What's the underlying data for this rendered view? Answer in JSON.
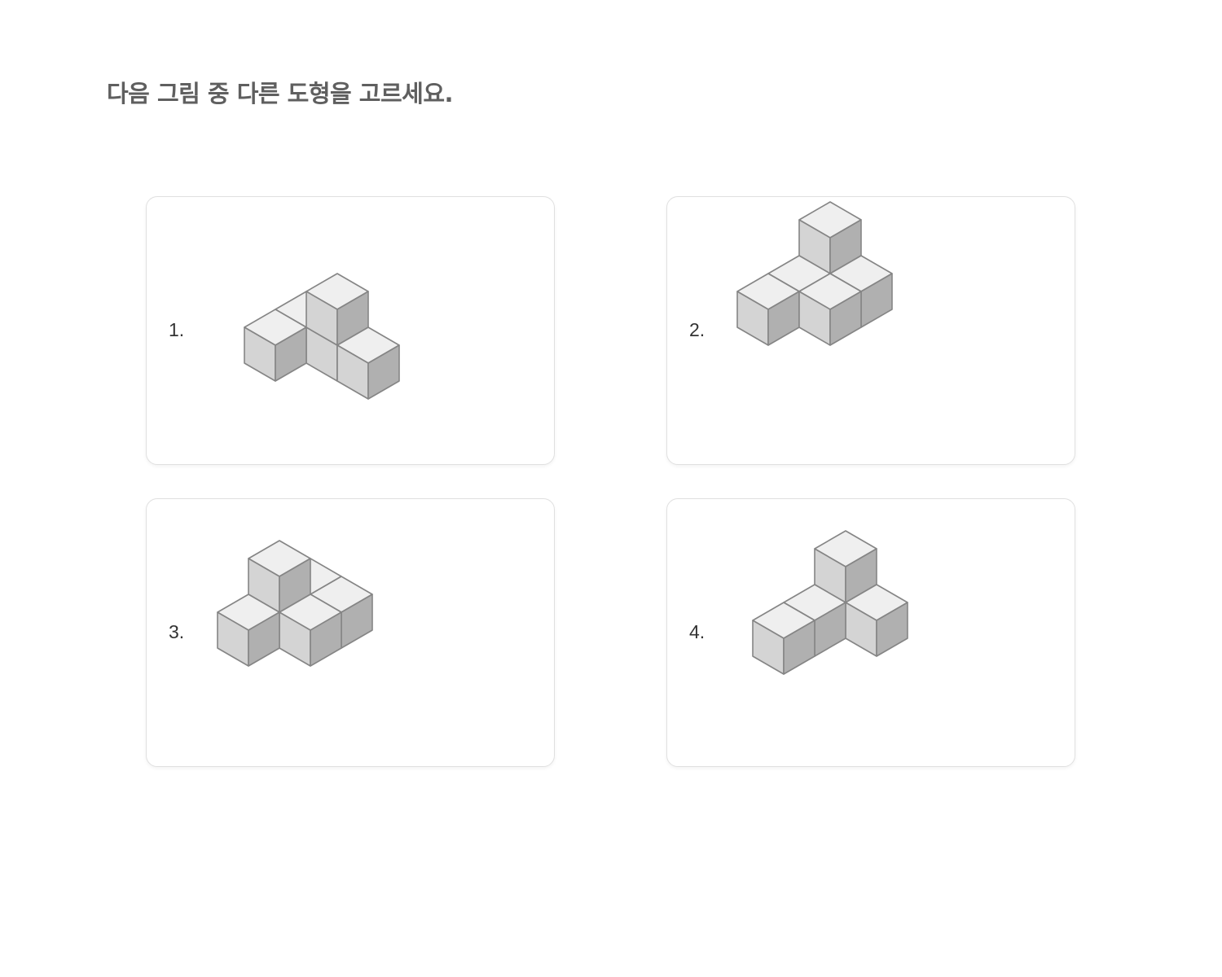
{
  "question": {
    "text": "다음 그림 중 다른 도형을 고르세요."
  },
  "options": [
    {
      "label": "1."
    },
    {
      "label": "2."
    },
    {
      "label": "3."
    },
    {
      "label": "4."
    }
  ],
  "colors": {
    "top_face": "#efefef",
    "left_face": "#d4d4d4",
    "right_face": "#b0b0b0",
    "edge": "#858585",
    "card_border": "#e0e0e0",
    "question_text": "#5f5f5f"
  }
}
